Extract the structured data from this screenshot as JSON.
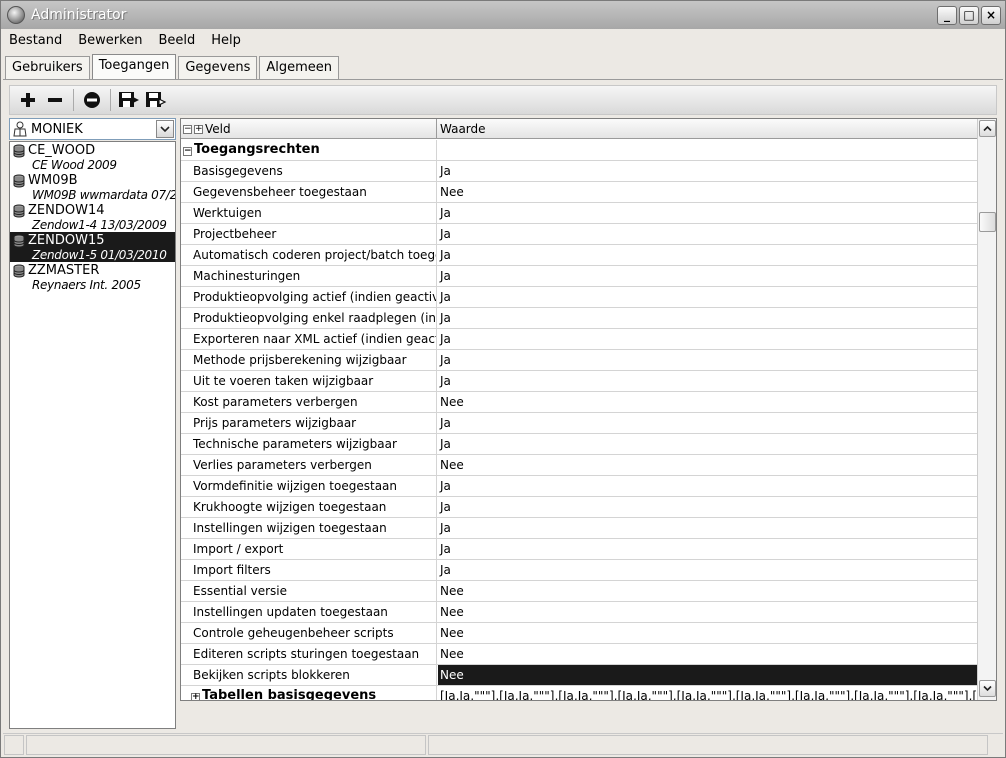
{
  "window": {
    "title": "Administrator",
    "controls": [
      "_",
      "□",
      "×"
    ]
  },
  "menu": [
    "Bestand",
    "Bewerken",
    "Beeld",
    "Help"
  ],
  "tabs": [
    {
      "label": "Gebruikers",
      "active": false
    },
    {
      "label": "Toegangen",
      "active": true
    },
    {
      "label": "Gegevens",
      "active": false
    },
    {
      "label": "Algemeen",
      "active": false
    }
  ],
  "toolbar": {
    "icons": [
      "add-icon",
      "remove-icon",
      "stop-icon",
      "save-icon",
      "save-as-icon"
    ]
  },
  "user_select": {
    "value": "MONIEK"
  },
  "databases": [
    {
      "name": "CE_WOOD",
      "desc": "CE Wood 2009",
      "selected": false
    },
    {
      "name": "WM09B",
      "desc": "WM09B wwmardata 07/2",
      "selected": false
    },
    {
      "name": "ZENDOW14",
      "desc": "Zendow1-4 13/03/2009",
      "selected": false
    },
    {
      "name": "ZENDOW15",
      "desc": "Zendow1-5 01/03/2010",
      "selected": true
    },
    {
      "name": "ZZMASTER",
      "desc": "Reynaers Int. 2005",
      "selected": false
    }
  ],
  "grid": {
    "headers": {
      "veld": "Veld",
      "waarde": "Waarde"
    },
    "section": "Toegangsrechten",
    "rows": [
      {
        "veld": "Basisgegevens",
        "waarde": "Ja"
      },
      {
        "veld": "Gegevensbeheer toegestaan",
        "waarde": "Nee"
      },
      {
        "veld": "Werktuigen",
        "waarde": "Ja"
      },
      {
        "veld": "Projectbeheer",
        "waarde": "Ja"
      },
      {
        "veld": "Automatisch coderen project/batch toegestaan",
        "waarde": "Ja"
      },
      {
        "veld": "Machinesturingen",
        "waarde": "Ja"
      },
      {
        "veld": "Produktieopvolging actief (indien geactiveerd)",
        "waarde": "Ja"
      },
      {
        "veld": "Produktieopvolging enkel raadplegen (indien)",
        "waarde": "Ja"
      },
      {
        "veld": "Exporteren naar XML actief (indien geactiveerd)",
        "waarde": "Ja"
      },
      {
        "veld": "Methode prijsberekening wijzigbaar",
        "waarde": "Ja"
      },
      {
        "veld": "Uit te voeren taken wijzigbaar",
        "waarde": "Ja"
      },
      {
        "veld": "Kost parameters verbergen",
        "waarde": "Nee"
      },
      {
        "veld": "Prijs parameters wijzigbaar",
        "waarde": "Ja"
      },
      {
        "veld": "Technische parameters wijzigbaar",
        "waarde": "Ja"
      },
      {
        "veld": "Verlies parameters verbergen",
        "waarde": "Nee"
      },
      {
        "veld": "Vormdefinitie wijzigen toegestaan",
        "waarde": "Ja"
      },
      {
        "veld": "Krukhoogte wijzigen toegestaan",
        "waarde": "Ja"
      },
      {
        "veld": "Instellingen wijzigen toegestaan",
        "waarde": "Ja"
      },
      {
        "veld": "Import / export",
        "waarde": "Ja"
      },
      {
        "veld": "Import filters",
        "waarde": "Ja"
      },
      {
        "veld": "Essential versie",
        "waarde": "Nee"
      },
      {
        "veld": "Instellingen updaten toegestaan",
        "waarde": "Nee"
      },
      {
        "veld": "Controle geheugenbeheer scripts",
        "waarde": "Nee"
      },
      {
        "veld": "Editeren scripts sturingen toegestaan",
        "waarde": "Nee"
      },
      {
        "veld": "Bekijken scripts blokkeren",
        "waarde": "Nee",
        "selected": true
      }
    ],
    "subsection": {
      "veld": "Tabellen basisgegevens",
      "waarde": "[Ja,Ja,\"\"\"],[Ja,Ja,\"\"\"],[Ja,Ja,\"\"\"],[Ja,Ja,\"\"\"],[Ja,Ja,\"\"\"],[Ja,Ja,\"\"\"],[Ja,Ja,\"\"\"],[Ja,Ja,\"\"\"],[Ja,Ja,\"\"\"],[J"
    }
  }
}
